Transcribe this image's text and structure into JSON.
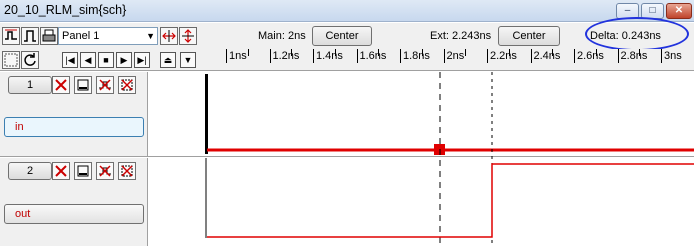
{
  "window": {
    "title": "20_10_RLM_sim{sch}",
    "minimize": "–",
    "maximize": "□",
    "close": "✕"
  },
  "toolbar": {
    "panel_select": "Panel 1",
    "main_label": "Main: 2ns",
    "center_label": "Center",
    "ext_label": "Ext: 2.243ns",
    "delta_label": "Delta: 0.243ns"
  },
  "ruler": {
    "labels": [
      "1ns",
      "1.2ns",
      "1.4ns",
      "1.6ns",
      "1.8ns",
      "2ns",
      "2.2ns",
      "2.4ns",
      "2.6ns",
      "2.8ns",
      "3ns"
    ]
  },
  "panels": [
    {
      "number": "1",
      "signal": "in",
      "selected": true
    },
    {
      "number": "2",
      "signal": "out",
      "selected": false
    }
  ],
  "icons": {
    "row1": [
      "waveform-icon",
      "pulse-icon",
      "printer-icon",
      "zoom-fit-icon",
      "zoom-vertical-icon"
    ],
    "row2": [
      "grid-icon",
      "refresh-icon",
      "first-icon",
      "prev-icon",
      "stop-icon",
      "next-icon",
      "last-icon",
      "eject-icon",
      "down-icon"
    ],
    "panel": [
      "delete-icon",
      "minimize-panel-icon",
      "delete-wave-icon",
      "settings-wave-icon"
    ]
  },
  "colors": {
    "wave": "#e00000",
    "accent": "#2233dd"
  }
}
